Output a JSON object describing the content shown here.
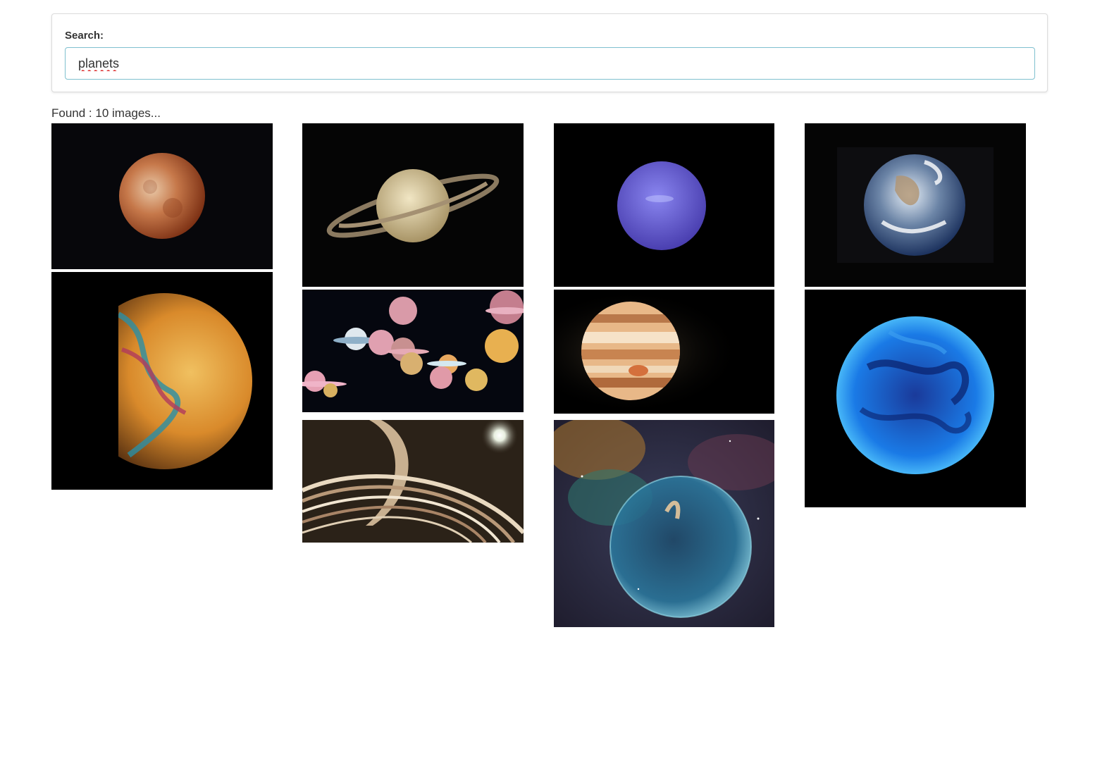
{
  "search": {
    "label": "Search:",
    "value": "planets"
  },
  "results": {
    "found_text": "Found : 10 images..."
  },
  "images": [
    {
      "name": "blood-moon-image"
    },
    {
      "name": "saturn-image"
    },
    {
      "name": "neptune-image"
    },
    {
      "name": "earth-image"
    },
    {
      "name": "soap-bubble-planet-image"
    },
    {
      "name": "colorful-ringed-planets-image"
    },
    {
      "name": "jupiter-image"
    },
    {
      "name": "blue-glowing-planet-image"
    },
    {
      "name": "ringed-planet-art-image"
    },
    {
      "name": "bubble-nebula-image"
    }
  ]
}
